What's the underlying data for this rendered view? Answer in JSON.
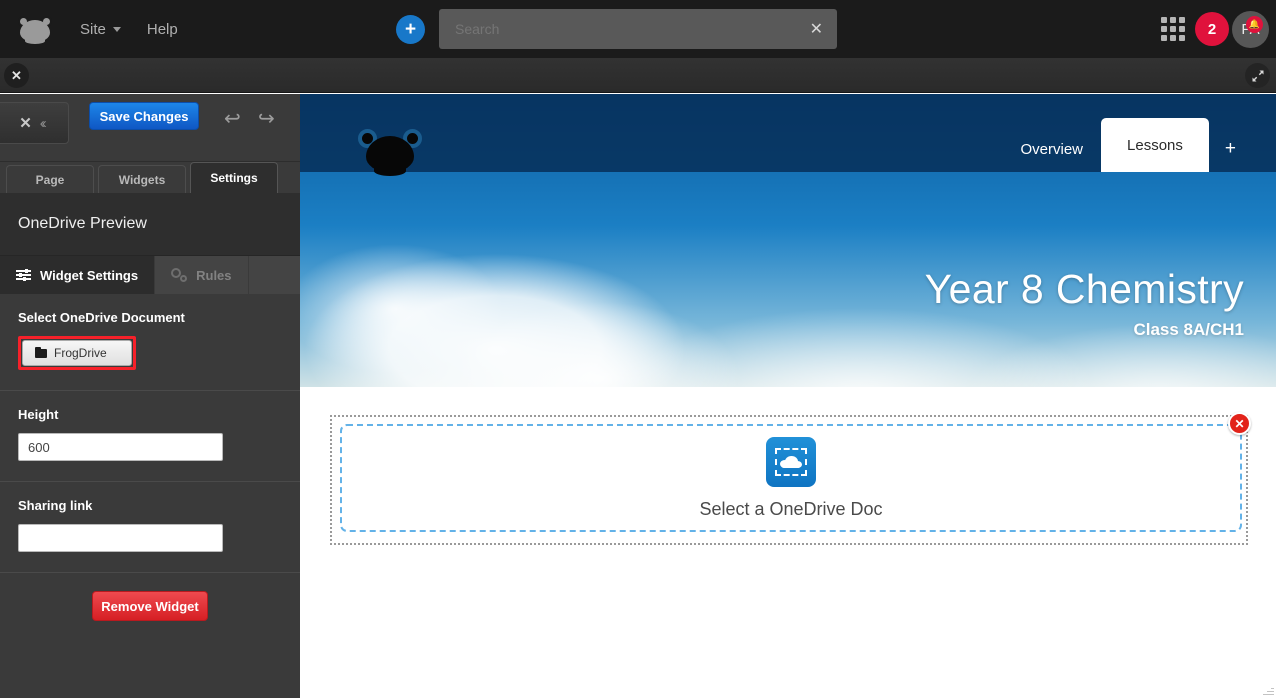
{
  "topbar": {
    "logo_icon": "frog-logo-icon",
    "site_label": "Site",
    "help_label": "Help",
    "add_button_label": "+",
    "search": {
      "value": "",
      "placeholder": "Search",
      "clear_label": "✕"
    },
    "apps_icon": "grid-apps-icon",
    "notification_count": "2",
    "avatar_initials": "FA",
    "bell_icon": "bell-icon",
    "accent_blue": "#1878c9",
    "accent_red": "#e0123c"
  },
  "secondbar": {
    "close_label": "✕",
    "expand_icon": "expand-arrows-icon"
  },
  "editor": {
    "collapse_label": "✕",
    "collapse_chevrons": "‹‹",
    "save_label": "Save Changes",
    "undo_icon": "undo-arrow-icon",
    "redo_icon": "redo-arrow-icon",
    "undo_glyph": "↩",
    "redo_glyph": "↪",
    "tabs": [
      {
        "label": "Page",
        "active": false
      },
      {
        "label": "Widgets",
        "active": false
      },
      {
        "label": "Settings",
        "active": true
      }
    ],
    "widget_title": "OneDrive Preview",
    "sub_tabs": [
      {
        "label": "Widget Settings",
        "icon": "sliders-icon",
        "active": true
      },
      {
        "label": "Rules",
        "icon": "gears-icon",
        "active": false
      }
    ],
    "fields": {
      "select_doc_label": "Select OneDrive Document",
      "frogdrive_button": "FrogDrive",
      "frogdrive_highlight_color": "#f6212a",
      "height_label": "Height",
      "height_value": "600",
      "sharing_link_label": "Sharing link",
      "sharing_link_value": "",
      "remove_label": "Remove Widget"
    }
  },
  "site": {
    "hero": {
      "logo_icon": "frog-head-icon",
      "tabs": [
        {
          "label": "Overview",
          "active": false
        },
        {
          "label": "Lessons",
          "active": true
        },
        {
          "label": "+",
          "active": false
        }
      ],
      "title": "Year 8 Chemistry",
      "subtitle": "Class 8A/CH1"
    },
    "widget": {
      "icon": "onedrive-cloud-icon",
      "label": "Select a OneDrive Doc",
      "close_label": "✕",
      "dashed_border_color": "#63b2e8",
      "close_color": "#e2231a"
    }
  }
}
